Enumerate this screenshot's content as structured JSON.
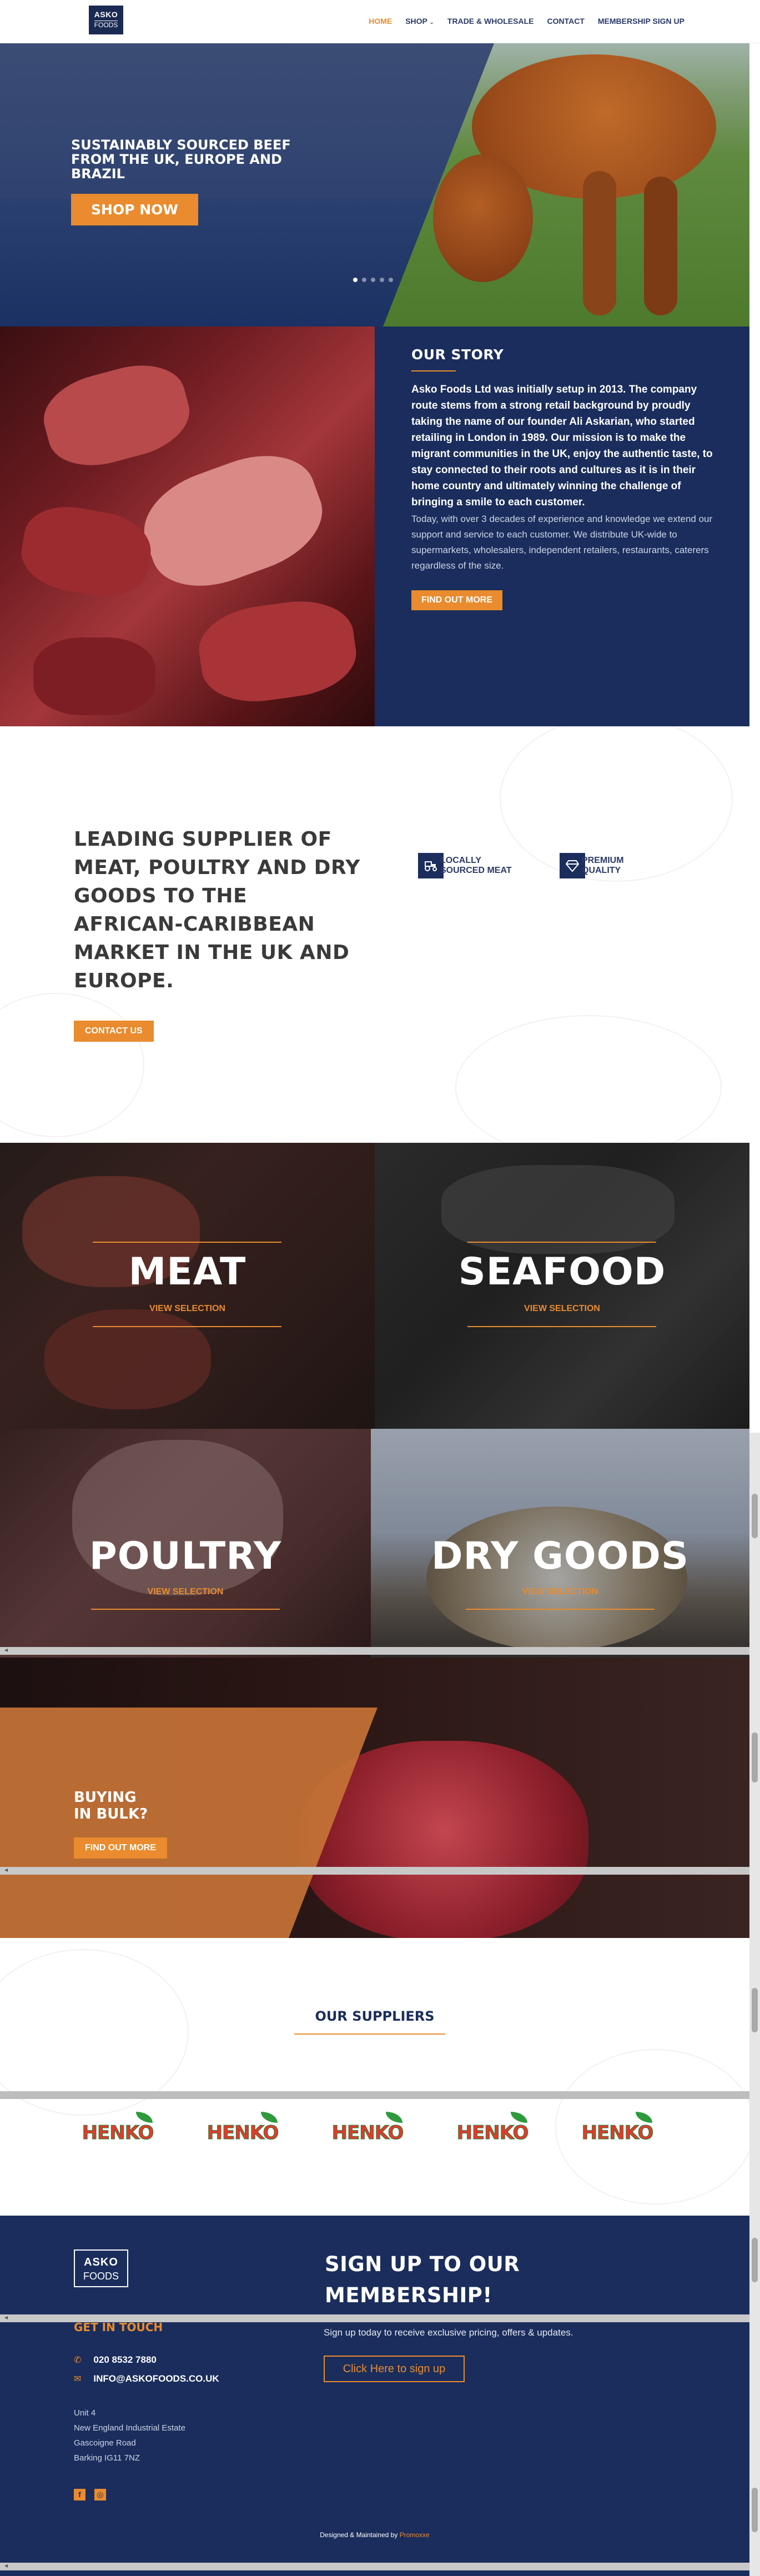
{
  "header": {
    "logo_top": "ASKO",
    "logo_bottom": "FOODS",
    "nav": [
      {
        "label": "HOME"
      },
      {
        "label": "SHOP"
      },
      {
        "label": "TRADE & WHOLESALE"
      },
      {
        "label": "CONTACT"
      },
      {
        "label": "MEMBERSHIP SIGN UP"
      }
    ],
    "active_color": "#e98b2e",
    "nav_color": "#2b3a67"
  },
  "hero": {
    "title": "SUSTAINABLY SOURCED BEEF FROM THE UK, EUROPE AND BRAZIL",
    "cta": "SHOP NOW",
    "slide_count": 5,
    "active_slide": 1
  },
  "story": {
    "heading": "OUR STORY",
    "lead": "Asko Foods Ltd was initially setup in 2013. The company route stems from a strong retail background by proudly taking the name of our founder Ali Askarian, who started retailing in London in 1989. Our mission is to make the migrant communities in the UK, enjoy the authentic taste, to stay connected to their roots and cultures as it is in their home country and ultimately winning the challenge of bringing a smile to each customer.",
    "body": "Today, with over 3 decades of experience and knowledge we extend our support and service to each customer. We distribute UK-wide to supermarkets, wholesalers, independent retailers, restaurants, caterers regardless of the size.",
    "cta": "FIND OUT MORE",
    "panel_color": "#1a2d5c"
  },
  "leading": {
    "heading": "LEADING SUPPLIER OF MEAT, POULTRY AND DRY GOODS TO THE AFRICAN-CARIBBEAN MARKET IN THE UK AND EUROPE.",
    "cta": "CONTACT US",
    "features": [
      {
        "line1": "LOCALLY",
        "line2": "SOURCED MEAT",
        "icon": "tractor-icon"
      },
      {
        "line1": "PREMIUM",
        "line2": "QUALITY",
        "icon": "diamond-icon"
      }
    ]
  },
  "categories": [
    {
      "title": "MEAT",
      "link": "VIEW SELECTION"
    },
    {
      "title": "SEAFOOD",
      "link": "VIEW SELECTION"
    },
    {
      "title": "POULTRY",
      "link": "VIEW SELECTION"
    },
    {
      "title": "DRY GOODS",
      "link": "VIEW SELECTION"
    }
  ],
  "bulk": {
    "line1": "BUYING",
    "line2": "IN BULK?",
    "cta": "FIND OUT MORE"
  },
  "suppliers": {
    "heading": "OUR SUPPLIERS",
    "logos": [
      "HENKO",
      "HENKO",
      "HENKO",
      "HENKO",
      "HENKO"
    ]
  },
  "footer": {
    "logo_top": "ASKO",
    "logo_bottom": "FOODS",
    "signup_title": "SIGN UP TO OUR MEMBERSHIP!",
    "signup_text": "Sign up today to receive exclusive pricing, offers & updates.",
    "signup_button": "Click Here to sign up",
    "get_in_touch": "GET IN TOUCH",
    "phone": "020 8532 7880",
    "email": "INFO@ASKOFOODS.CO.UK",
    "address": [
      "Unit 4",
      "New England Industrial Estate",
      "Gascoigne Road",
      "Barking IG11 7NZ"
    ],
    "social": [
      {
        "icon": "facebook-icon",
        "glyph": "f"
      },
      {
        "icon": "instagram-icon",
        "glyph": "◎"
      }
    ],
    "credit_prefix": "Designed & Maintained by ",
    "credit_brand": "Promoxxe"
  }
}
